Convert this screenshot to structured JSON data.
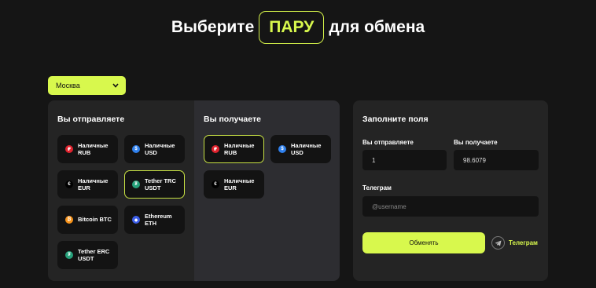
{
  "hero": {
    "before": "Выберите",
    "pill": "ПАРУ",
    "after": "для обмена"
  },
  "city": {
    "label": "Москва"
  },
  "send": {
    "title": "Вы отправляете",
    "items": [
      {
        "line1": "Наличные",
        "line2": "RUB",
        "icon": "ruble-icon",
        "glyph": "₽",
        "color": "#e0232e",
        "active": false
      },
      {
        "line1": "Наличные",
        "line2": "USD",
        "icon": "dollar-icon",
        "glyph": "$",
        "color": "#2f80ed",
        "active": false
      },
      {
        "line1": "Наличные",
        "line2": "EUR",
        "icon": "euro-icon",
        "glyph": "€",
        "color": "#000000",
        "active": false
      },
      {
        "line1": "Tether TRC",
        "line2": "USDT",
        "icon": "tether-icon",
        "glyph": "₮",
        "color": "#26a17b",
        "active": true
      },
      {
        "line1": "Bitcoin BTC",
        "line2": "",
        "icon": "bitcoin-icon",
        "glyph": "₿",
        "color": "#f7931a",
        "active": false
      },
      {
        "line1": "Ethereum",
        "line2": "ETH",
        "icon": "ethereum-icon",
        "glyph": "◆",
        "color": "#3c5ee8",
        "active": false
      },
      {
        "line1": "Tether ERC",
        "line2": "USDT",
        "icon": "tether-icon",
        "glyph": "₮",
        "color": "#26a17b",
        "active": false
      }
    ]
  },
  "receive": {
    "title": "Вы получаете",
    "items": [
      {
        "line1": "Наличные",
        "line2": "RUB",
        "icon": "ruble-icon",
        "glyph": "₽",
        "color": "#e0232e",
        "active": true
      },
      {
        "line1": "Наличные",
        "line2": "USD",
        "icon": "dollar-icon",
        "glyph": "$",
        "color": "#2f80ed",
        "active": false
      },
      {
        "line1": "Наличные",
        "line2": "EUR",
        "icon": "euro-icon",
        "glyph": "€",
        "color": "#000000",
        "active": false
      }
    ]
  },
  "form": {
    "title": "Заполните поля",
    "send_label": "Вы отправляете",
    "send_value": "1",
    "receive_label": "Вы получаете",
    "receive_value": "98.6079",
    "telegram_label": "Телеграм",
    "telegram_placeholder": "@username",
    "submit_label": "Обменять",
    "telegram_link": "Телеграм"
  },
  "colors": {
    "accent": "#d8f84d",
    "bg": "#151515",
    "panel": "#242424"
  }
}
